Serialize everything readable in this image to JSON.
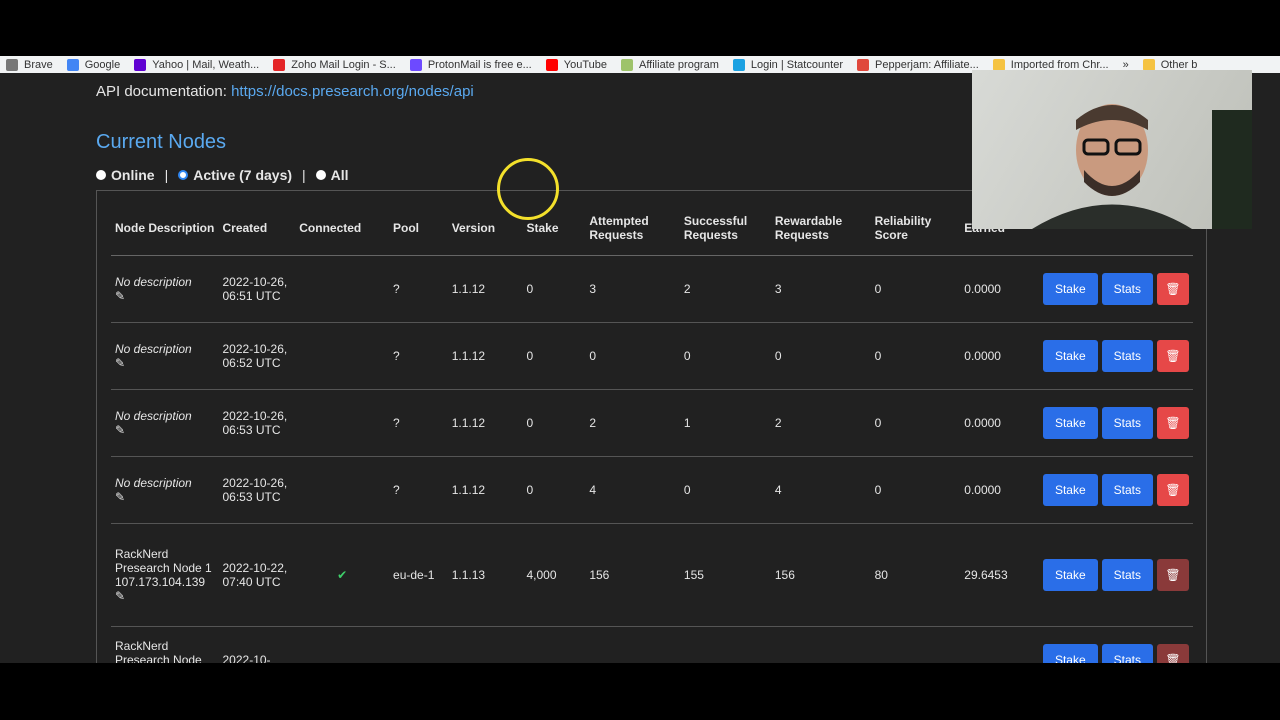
{
  "bookmarks": [
    {
      "label": "Brave",
      "color": "#777777"
    },
    {
      "label": "Google",
      "color": "#4285f4"
    },
    {
      "label": "Yahoo | Mail, Weath...",
      "color": "#6001d2"
    },
    {
      "label": "Zoho Mail Login - S...",
      "color": "#e42527"
    },
    {
      "label": "ProtonMail is free e...",
      "color": "#6d4aff"
    },
    {
      "label": "YouTube",
      "color": "#ff0000"
    },
    {
      "label": "Affiliate program",
      "color": "#9ec36a"
    },
    {
      "label": "Login | Statcounter",
      "color": "#1ba1e2"
    },
    {
      "label": "Pepperjam: Affiliate...",
      "color": "#e0483c"
    },
    {
      "label": "Imported from Chr...",
      "color": "#f5c342"
    },
    {
      "label": "»",
      "color": ""
    },
    {
      "label": "Other b",
      "color": "#f5c342"
    }
  ],
  "api": {
    "prefix": "API documentation:",
    "link": "https://docs.presearch.org/nodes/api"
  },
  "title": "Current Nodes",
  "filters": {
    "online": "Online",
    "active": "Active (7 days)",
    "all": "All",
    "sep": "|"
  },
  "columns": [
    "Node Description",
    "Created",
    "Connected",
    "Pool",
    "Version",
    "Stake",
    "Attempted Requests",
    "Successful Requests",
    "Rewardable Requests",
    "Reliability Score",
    "Earned"
  ],
  "buttons": {
    "stake": "Stake",
    "stats": "Stats"
  },
  "rows": [
    {
      "desc": "No description",
      "created": "2022-10-26, 06:51 UTC",
      "connected": "",
      "pool": "?",
      "version": "1.1.12",
      "stake": "0",
      "attempted": "3",
      "successful": "2",
      "rewardable": "3",
      "reliability": "0",
      "earned": "0.0000"
    },
    {
      "desc": "No description",
      "created": "2022-10-26, 06:52 UTC",
      "connected": "",
      "pool": "?",
      "version": "1.1.12",
      "stake": "0",
      "attempted": "0",
      "successful": "0",
      "rewardable": "0",
      "reliability": "0",
      "earned": "0.0000"
    },
    {
      "desc": "No description",
      "created": "2022-10-26, 06:53 UTC",
      "connected": "",
      "pool": "?",
      "version": "1.1.12",
      "stake": "0",
      "attempted": "2",
      "successful": "1",
      "rewardable": "2",
      "reliability": "0",
      "earned": "0.0000"
    },
    {
      "desc": "No description",
      "created": "2022-10-26, 06:53 UTC",
      "connected": "",
      "pool": "?",
      "version": "1.1.12",
      "stake": "0",
      "attempted": "4",
      "successful": "0",
      "rewardable": "4",
      "reliability": "0",
      "earned": "0.0000"
    },
    {
      "desc": "RackNerd Presearch Node 1 107.173.104.139",
      "created": "2022-10-22, 07:40 UTC",
      "connected": "plug-icon",
      "pool": "eu-de-1",
      "version": "1.1.13",
      "stake": "4,000",
      "attempted": "156",
      "successful": "155",
      "rewardable": "156",
      "reliability": "80",
      "earned": "29.6453"
    },
    {
      "desc": "RackNerd Presearch Node",
      "created": "2022-10-",
      "connected": "",
      "pool": "",
      "version": "",
      "stake": "",
      "attempted": "",
      "successful": "",
      "rewardable": "",
      "reliability": "",
      "earned": ""
    }
  ]
}
